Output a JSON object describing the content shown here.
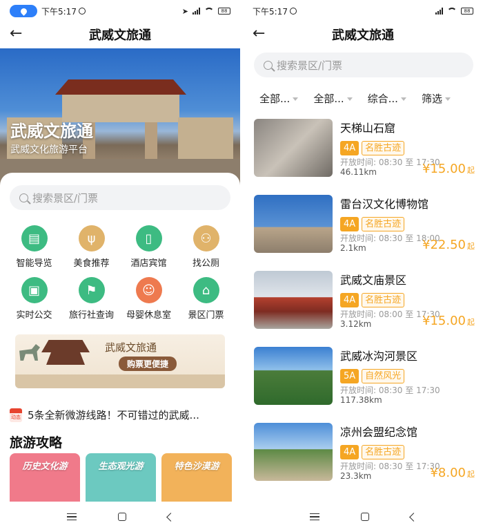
{
  "status_bar": {
    "time": "下午5:17",
    "battery": "88"
  },
  "header": {
    "title": "武威文旅通"
  },
  "hero": {
    "title": "武威文旅通",
    "subtitle": "武威文化旅游平台"
  },
  "search": {
    "placeholder": "搜索景区/门票"
  },
  "services": [
    {
      "label": "智能导览",
      "icon": "map-book-icon",
      "color": "#3dbb82"
    },
    {
      "label": "美食推荐",
      "icon": "fork-knife-icon",
      "color": "#e0b36a"
    },
    {
      "label": "酒店宾馆",
      "icon": "door-icon",
      "color": "#3dbb82"
    },
    {
      "label": "找公厕",
      "icon": "toilet-icon",
      "color": "#e0b36a"
    },
    {
      "label": "实时公交",
      "icon": "bus-icon",
      "color": "#3dbb82"
    },
    {
      "label": "旅行社查询",
      "icon": "flag-icon",
      "color": "#3dbb82"
    },
    {
      "label": "母婴休息室",
      "icon": "baby-icon",
      "color": "#ee7a4f"
    },
    {
      "label": "景区门票",
      "icon": "building-icon",
      "color": "#3dbb82"
    }
  ],
  "banner": {
    "title": "武威文旅通",
    "button": "购票更便捷"
  },
  "news": {
    "tag": "最新动态",
    "text": "5条全新微游线路！不可错过的武威..."
  },
  "guides_section": {
    "title": "旅游攻略",
    "items": [
      {
        "label": "历史文化游",
        "color": "#f07a8a"
      },
      {
        "label": "生态观光游",
        "color": "#6cc9c0"
      },
      {
        "label": "特色沙漠游",
        "color": "#f2b25a"
      }
    ]
  },
  "filters": [
    "全部...",
    "全部...",
    "综合...",
    "筛选"
  ],
  "attractions": [
    {
      "name": "天梯山石窟",
      "level": "4A",
      "category": "名胜古迹",
      "hours": "开放时间: 08:30 至 17:30",
      "distance": "46.11km",
      "price": "¥15.00",
      "unit": "起"
    },
    {
      "name": "雷台汉文化博物馆",
      "level": "4A",
      "category": "名胜古迹",
      "hours": "开放时间: 08:30 至 18:00",
      "distance": "2.1km",
      "price": "¥22.50",
      "unit": "起"
    },
    {
      "name": "武威文庙景区",
      "level": "4A",
      "category": "名胜古迹",
      "hours": "开放时间: 08:00 至 17:30",
      "distance": "3.12km",
      "price": "¥15.00",
      "unit": "起"
    },
    {
      "name": "武威冰沟河景区",
      "level": "5A",
      "category": "自然风光",
      "hours": "开放时间: 08:30 至 17:30",
      "distance": "117.38km",
      "price": "",
      "unit": ""
    },
    {
      "name": "凉州会盟纪念馆",
      "level": "4A",
      "category": "名胜古迹",
      "hours": "开放时间: 08:30 至 17:30",
      "distance": "23.3km",
      "price": "¥8.00",
      "unit": "起"
    }
  ]
}
